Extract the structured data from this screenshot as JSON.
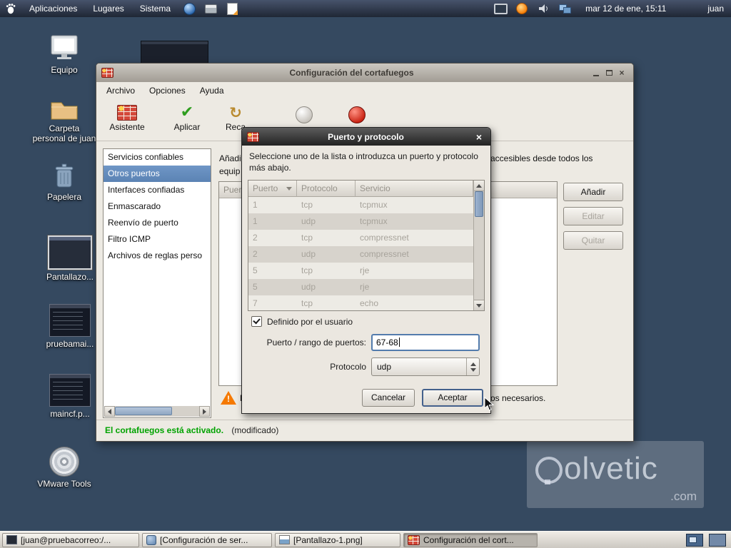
{
  "icons": {
    "close_glyph": "×",
    "check_glyph": "✔",
    "reload_glyph": "↻",
    "warning_glyph": "!"
  },
  "panel": {
    "menus": [
      "Aplicaciones",
      "Lugares",
      "Sistema"
    ],
    "clock": "mar 12 de ene, 15:11",
    "user": "juan"
  },
  "desktop": {
    "icons": [
      "Equipo",
      "Carpeta personal de juan",
      "Papelera",
      "Pantallazo...",
      "pruebamai...",
      "maincf.p...",
      "VMware Tools"
    ],
    "watermark_text": "olvetic",
    "watermark_suffix": ".com"
  },
  "main_window": {
    "title": "Configuración del cortafuegos",
    "menus": [
      "Archivo",
      "Opciones",
      "Ayuda"
    ],
    "toolbar": [
      "Asistente",
      "Aplicar",
      "Reca"
    ],
    "sidebar_items": [
      "Servicios confiables",
      "Otros puertos",
      "Interfaces confiadas",
      "Enmascarado",
      "Reenvío de puerto",
      "Filtro ICMP",
      "Archivos de reglas perso"
    ],
    "desc_line1_left": "Añadi",
    "desc_line1_right": "accesibles desde todos los",
    "desc_line2_left": "equip",
    "table_header_left": "Puer",
    "action_buttons": [
      "Añadir",
      "Editar",
      "Quitar"
    ],
    "warning_left": "F",
    "warning_right": "os necesarios.",
    "status_text": "El cortafuegos está activado.",
    "status_modified": "(modificado)"
  },
  "dialog": {
    "title": "Puerto y protocolo",
    "instruction": "Seleccione uno de la lista o introduzca un puerto y protocolo más abajo.",
    "columns": [
      "Puerto",
      "Protocolo",
      "Servicio"
    ],
    "rows": [
      [
        "1",
        "tcp",
        "tcpmux"
      ],
      [
        "1",
        "udp",
        "tcpmux"
      ],
      [
        "2",
        "tcp",
        "compressnet"
      ],
      [
        "2",
        "udp",
        "compressnet"
      ],
      [
        "5",
        "tcp",
        "rje"
      ],
      [
        "5",
        "udp",
        "rje"
      ],
      [
        "7",
        "tcp",
        "echo"
      ]
    ],
    "user_defined_label": "Definido por el usuario",
    "port_label": "Puerto / rango de puertos:",
    "port_value": "67-68",
    "protocol_label": "Protocolo",
    "protocol_value": "udp",
    "cancel_label": "Cancelar",
    "ok_label": "Aceptar"
  },
  "taskbar": {
    "items": [
      "[juan@pruebacorreo:/...",
      "[Configuración de ser...",
      "[Pantallazo-1.png]",
      "Configuración del cort..."
    ]
  }
}
